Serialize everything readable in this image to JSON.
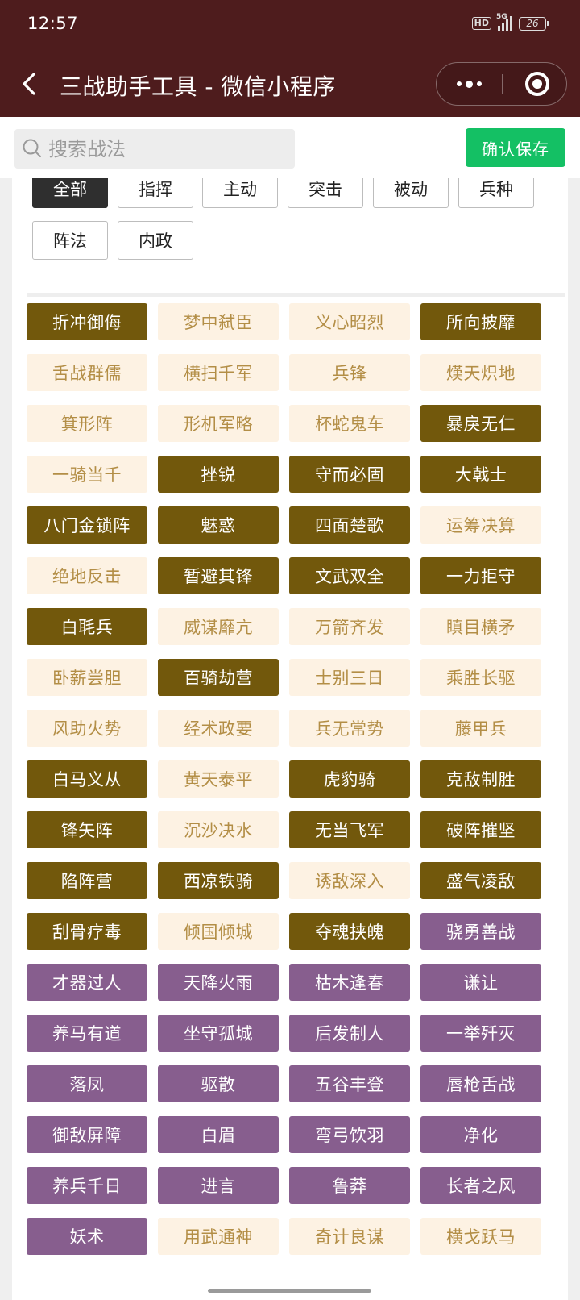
{
  "status_bar": {
    "time": "12:57",
    "hd": "HD",
    "network": "5G",
    "battery": "26"
  },
  "nav": {
    "title": "三战助手工具 - 微信小程序"
  },
  "search": {
    "placeholder": "搜索战法",
    "value": "",
    "save_label": "确认保存"
  },
  "filters": [
    {
      "label": "全部",
      "active": true
    },
    {
      "label": "指挥",
      "active": false
    },
    {
      "label": "主动",
      "active": false
    },
    {
      "label": "突击",
      "active": false
    },
    {
      "label": "被动",
      "active": false
    },
    {
      "label": "兵种",
      "active": false
    },
    {
      "label": "阵法",
      "active": false
    },
    {
      "label": "内政",
      "active": false
    }
  ],
  "colors": {
    "gold": "#72580c",
    "light": "#fdf2e3",
    "light_text": "#b38e46",
    "purple": "#875e8e",
    "save": "#14c064",
    "header": "#4e1c1d"
  },
  "skills": [
    {
      "name": "折冲御侮",
      "style": "gold"
    },
    {
      "name": "梦中弑臣",
      "style": "light"
    },
    {
      "name": "义心昭烈",
      "style": "light"
    },
    {
      "name": "所向披靡",
      "style": "gold"
    },
    {
      "name": "舌战群儒",
      "style": "light"
    },
    {
      "name": "横扫千军",
      "style": "light"
    },
    {
      "name": "兵锋",
      "style": "light"
    },
    {
      "name": "熯天炽地",
      "style": "light"
    },
    {
      "name": "箕形阵",
      "style": "light"
    },
    {
      "name": "形机军略",
      "style": "light"
    },
    {
      "name": "杯蛇鬼车",
      "style": "light"
    },
    {
      "name": "暴戾无仁",
      "style": "gold"
    },
    {
      "name": "一骑当千",
      "style": "light"
    },
    {
      "name": "挫锐",
      "style": "gold"
    },
    {
      "name": "守而必固",
      "style": "gold"
    },
    {
      "name": "大戟士",
      "style": "gold"
    },
    {
      "name": "八门金锁阵",
      "style": "gold"
    },
    {
      "name": "魅惑",
      "style": "gold"
    },
    {
      "name": "四面楚歌",
      "style": "gold"
    },
    {
      "name": "运筹决算",
      "style": "light"
    },
    {
      "name": "绝地反击",
      "style": "light"
    },
    {
      "name": "暂避其锋",
      "style": "gold"
    },
    {
      "name": "文武双全",
      "style": "gold"
    },
    {
      "name": "一力拒守",
      "style": "gold"
    },
    {
      "name": "白毦兵",
      "style": "gold"
    },
    {
      "name": "威谋靡亢",
      "style": "light"
    },
    {
      "name": "万箭齐发",
      "style": "light"
    },
    {
      "name": "瞋目横矛",
      "style": "light"
    },
    {
      "name": "卧薪尝胆",
      "style": "light"
    },
    {
      "name": "百骑劫营",
      "style": "gold"
    },
    {
      "name": "士别三日",
      "style": "light"
    },
    {
      "name": "乘胜长驱",
      "style": "light"
    },
    {
      "name": "风助火势",
      "style": "light"
    },
    {
      "name": "经术政要",
      "style": "light"
    },
    {
      "name": "兵无常势",
      "style": "light"
    },
    {
      "name": "藤甲兵",
      "style": "light"
    },
    {
      "name": "白马义从",
      "style": "gold"
    },
    {
      "name": "黄天泰平",
      "style": "light"
    },
    {
      "name": "虎豹骑",
      "style": "gold"
    },
    {
      "name": "克敌制胜",
      "style": "gold"
    },
    {
      "name": "锋矢阵",
      "style": "gold"
    },
    {
      "name": "沉沙决水",
      "style": "light"
    },
    {
      "name": "无当飞军",
      "style": "gold"
    },
    {
      "name": "破阵摧坚",
      "style": "gold"
    },
    {
      "name": "陷阵营",
      "style": "gold"
    },
    {
      "name": "西凉铁骑",
      "style": "gold"
    },
    {
      "name": "诱敌深入",
      "style": "light"
    },
    {
      "name": "盛气凌敌",
      "style": "gold"
    },
    {
      "name": "刮骨疗毒",
      "style": "gold"
    },
    {
      "name": "倾国倾城",
      "style": "light"
    },
    {
      "name": "夺魂挟魄",
      "style": "gold"
    },
    {
      "name": "骁勇善战",
      "style": "purple"
    },
    {
      "name": "才器过人",
      "style": "purple"
    },
    {
      "name": "天降火雨",
      "style": "purple"
    },
    {
      "name": "枯木逢春",
      "style": "purple"
    },
    {
      "name": "谦让",
      "style": "purple"
    },
    {
      "name": "养马有道",
      "style": "purple"
    },
    {
      "name": "坐守孤城",
      "style": "purple"
    },
    {
      "name": "后发制人",
      "style": "purple"
    },
    {
      "name": "一举歼灭",
      "style": "purple"
    },
    {
      "name": "落凤",
      "style": "purple"
    },
    {
      "name": "驱散",
      "style": "purple"
    },
    {
      "name": "五谷丰登",
      "style": "purple"
    },
    {
      "name": "唇枪舌战",
      "style": "purple"
    },
    {
      "name": "御敌屏障",
      "style": "purple"
    },
    {
      "name": "白眉",
      "style": "purple"
    },
    {
      "name": "弯弓饮羽",
      "style": "purple"
    },
    {
      "name": "净化",
      "style": "purple"
    },
    {
      "name": "养兵千日",
      "style": "purple"
    },
    {
      "name": "进言",
      "style": "purple"
    },
    {
      "name": "鲁莽",
      "style": "purple"
    },
    {
      "name": "长者之风",
      "style": "purple"
    },
    {
      "name": "妖术",
      "style": "purple"
    },
    {
      "name": "用武通神",
      "style": "light"
    },
    {
      "name": "奇计良谋",
      "style": "light"
    },
    {
      "name": "横戈跃马",
      "style": "light"
    }
  ]
}
